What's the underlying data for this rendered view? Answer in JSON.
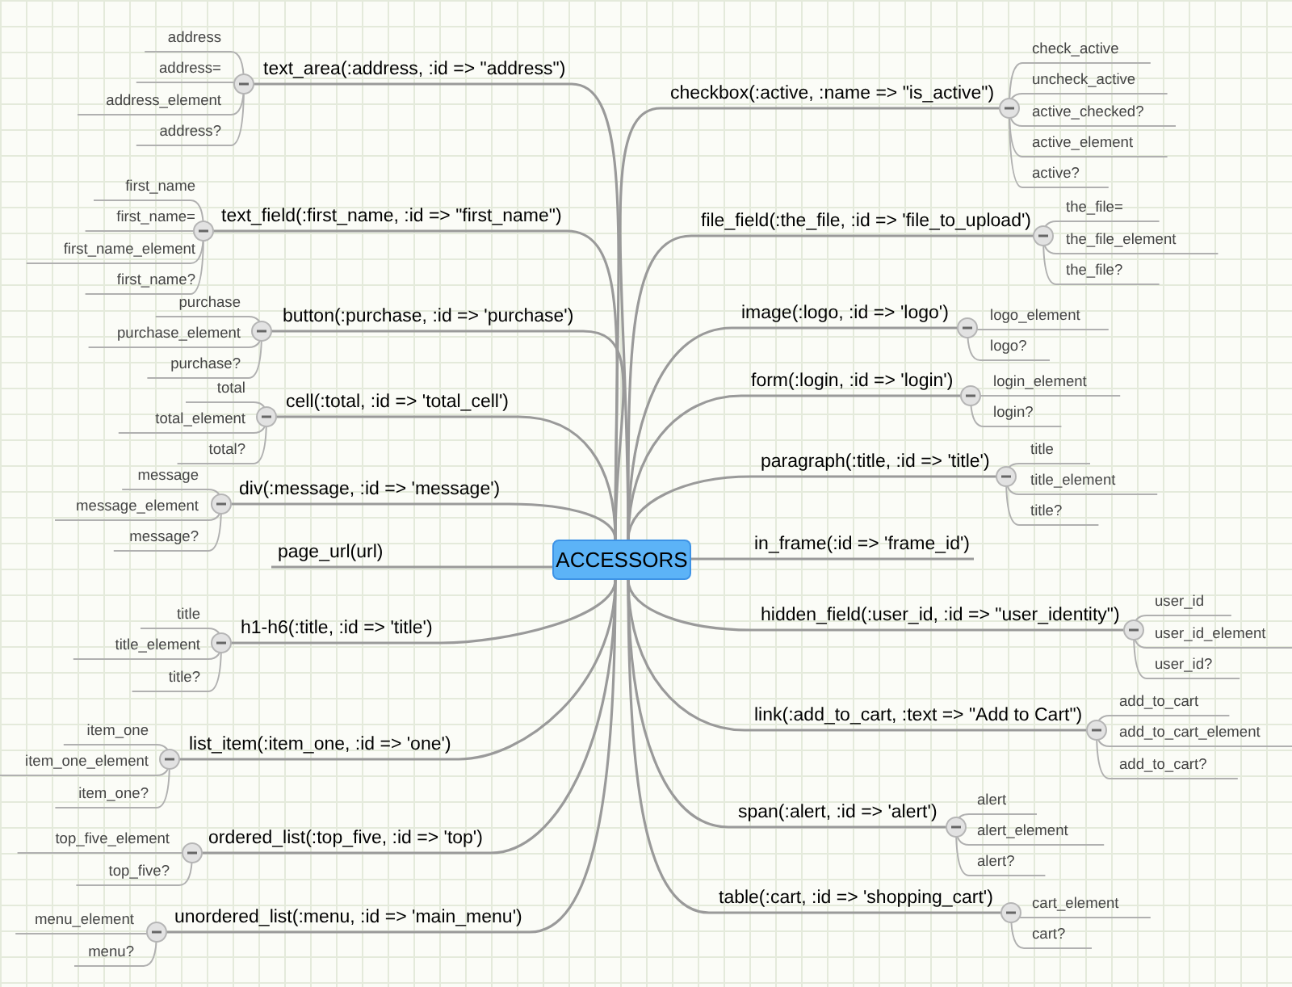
{
  "root": {
    "label": "ACCESSORS"
  },
  "left_branches": [
    {
      "label": "text_area(:address, :id => \"address\")",
      "expanded": true,
      "children": [
        {
          "label": "address"
        },
        {
          "label": "address="
        },
        {
          "label": "address_element"
        },
        {
          "label": "address?"
        }
      ]
    },
    {
      "label": "text_field(:first_name, :id => \"first_name\")",
      "expanded": true,
      "children": [
        {
          "label": "first_name"
        },
        {
          "label": "first_name="
        },
        {
          "label": "first_name_element"
        },
        {
          "label": "first_name?"
        }
      ]
    },
    {
      "label": "button(:purchase, :id => 'purchase')",
      "expanded": true,
      "children": [
        {
          "label": "purchase"
        },
        {
          "label": "purchase_element"
        },
        {
          "label": "purchase?"
        }
      ]
    },
    {
      "label": "cell(:total, :id => 'total_cell')",
      "expanded": true,
      "children": [
        {
          "label": "total"
        },
        {
          "label": "total_element"
        },
        {
          "label": "total?"
        }
      ]
    },
    {
      "label": "div(:message, :id => 'message')",
      "expanded": true,
      "children": [
        {
          "label": "message"
        },
        {
          "label": "message_element"
        },
        {
          "label": "message?"
        }
      ]
    },
    {
      "label": "page_url(url)"
    },
    {
      "label": "h1-h6(:title, :id => 'title')",
      "expanded": true,
      "children": [
        {
          "label": "title"
        },
        {
          "label": "title_element"
        },
        {
          "label": "title?"
        }
      ]
    },
    {
      "label": "list_item(:item_one, :id => 'one')",
      "expanded": true,
      "children": [
        {
          "label": "item_one"
        },
        {
          "label": "item_one_element"
        },
        {
          "label": "item_one?"
        }
      ]
    },
    {
      "label": "ordered_list(:top_five, :id => 'top')",
      "expanded": true,
      "children": [
        {
          "label": "top_five_element"
        },
        {
          "label": "top_five?"
        }
      ]
    },
    {
      "label": "unordered_list(:menu, :id => 'main_menu')",
      "expanded": true,
      "children": [
        {
          "label": "menu_element"
        },
        {
          "label": "menu?"
        }
      ]
    }
  ],
  "right_branches": [
    {
      "label": "checkbox(:active, :name => \"is_active\")",
      "expanded": true,
      "children": [
        {
          "label": "check_active"
        },
        {
          "label": "uncheck_active"
        },
        {
          "label": "active_checked?"
        },
        {
          "label": "active_element"
        },
        {
          "label": "active?"
        }
      ]
    },
    {
      "label": "file_field(:the_file, :id => 'file_to_upload')",
      "expanded": true,
      "children": [
        {
          "label": "the_file="
        },
        {
          "label": "the_file_element"
        },
        {
          "label": "the_file?"
        }
      ]
    },
    {
      "label": "image(:logo, :id => 'logo')",
      "expanded": true,
      "children": [
        {
          "label": "logo_element"
        },
        {
          "label": "logo?"
        }
      ]
    },
    {
      "label": "form(:login, :id => 'login')",
      "expanded": true,
      "children": [
        {
          "label": "login_element"
        },
        {
          "label": "login?"
        }
      ]
    },
    {
      "label": "paragraph(:title, :id => 'title')",
      "expanded": true,
      "children": [
        {
          "label": "title"
        },
        {
          "label": "title_element"
        },
        {
          "label": "title?"
        }
      ]
    },
    {
      "label": "in_frame(:id => 'frame_id')"
    },
    {
      "label": "hidden_field(:user_id, :id => \"user_identity\")",
      "expanded": true,
      "children": [
        {
          "label": "user_id"
        },
        {
          "label": "user_id_element"
        },
        {
          "label": "user_id?"
        }
      ]
    },
    {
      "label": "link(:add_to_cart, :text => \"Add to Cart\")",
      "expanded": true,
      "children": [
        {
          "label": "add_to_cart"
        },
        {
          "label": "add_to_cart_element"
        },
        {
          "label": "add_to_cart?"
        }
      ]
    },
    {
      "label": "span(:alert, :id => 'alert')",
      "expanded": true,
      "children": [
        {
          "label": "alert"
        },
        {
          "label": "alert_element"
        },
        {
          "label": "alert?"
        }
      ]
    },
    {
      "label": "table(:cart, :id => 'shopping_cart')",
      "expanded": true,
      "children": [
        {
          "label": "cart_element"
        },
        {
          "label": "cart?"
        }
      ]
    }
  ]
}
